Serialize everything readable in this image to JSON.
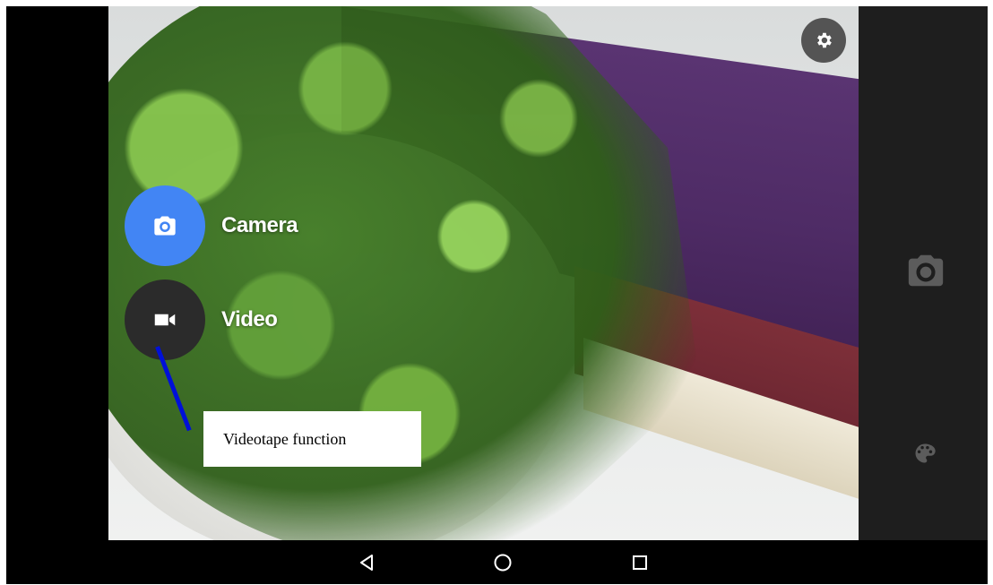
{
  "modes": [
    {
      "label": "Camera",
      "icon": "camera-icon",
      "color": "#4285f4"
    },
    {
      "label": "Video",
      "icon": "videocam-icon",
      "color": "#2b2b2b"
    }
  ],
  "annotation": {
    "text": "Videotape function",
    "line_color": "#0010d8"
  },
  "top_controls": {
    "settings_icon": "gear-icon"
  },
  "side_panel": {
    "icons": [
      "camera-icon",
      "palette-icon"
    ]
  },
  "nav_bar": {
    "icons": [
      "back-icon",
      "home-icon",
      "recents-icon"
    ]
  }
}
